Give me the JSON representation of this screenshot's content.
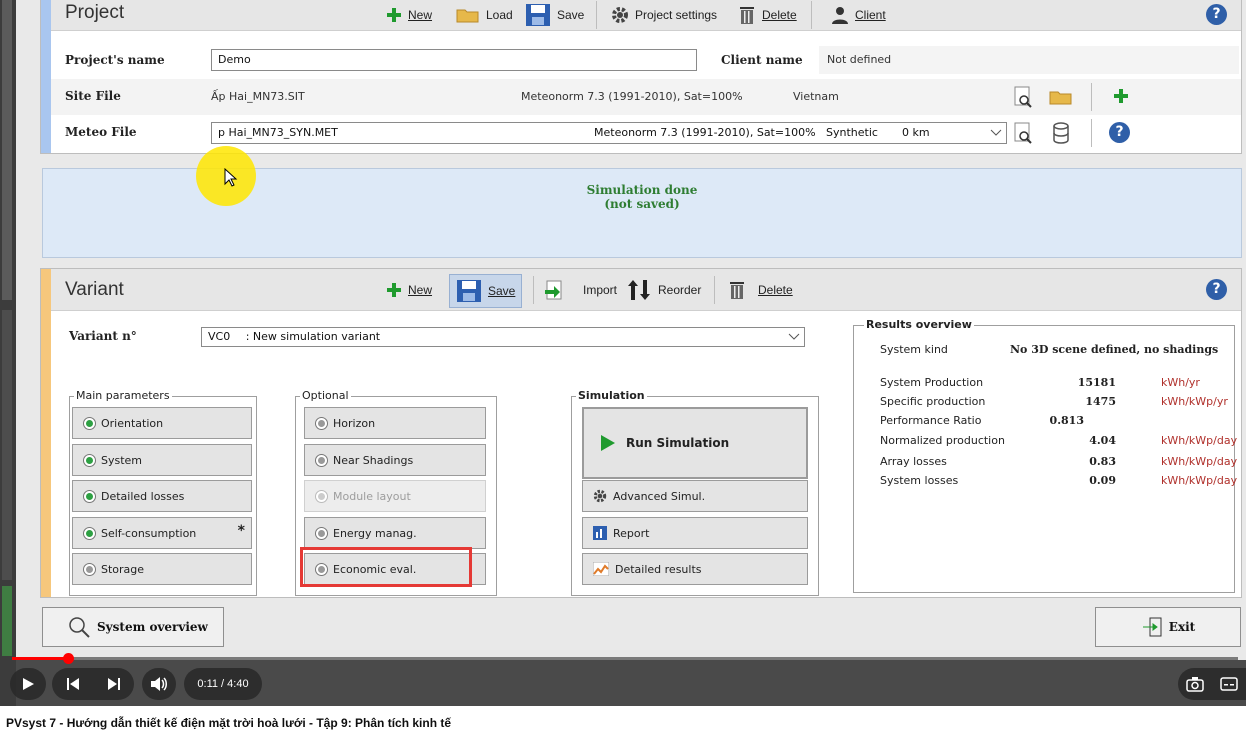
{
  "project": {
    "title": "Project",
    "toolbar": {
      "new": "New",
      "load": "Load",
      "save": "Save",
      "settings": "Project settings",
      "delete": "Delete",
      "client": "Client"
    },
    "name_label": "Project's name",
    "name_value": "Demo",
    "client_label": "Client name",
    "client_value": "Not defined",
    "site_label": "Site File",
    "site_file": "Ấp Hai_MN73.SIT",
    "site_meteo": "Meteonorm 7.3 (1991-2010), Sat=100%",
    "site_country": "Vietnam",
    "meteo_label": "Meteo File",
    "meteo_file": "p Hai_MN73_SYN.MET",
    "meteo_source": "Meteonorm 7.3 (1991-2010), Sat=100%",
    "meteo_type": "Synthetic",
    "meteo_dist": "0 km"
  },
  "status": {
    "line1": "Simulation done",
    "line2": "(not saved)"
  },
  "variant": {
    "title": "Variant",
    "toolbar": {
      "new": "New",
      "save": "Save",
      "import": "Import",
      "reorder": "Reorder",
      "delete": "Delete"
    },
    "number_label": "Variant n°",
    "number_code": "VC0",
    "number_name": ": New simulation variant"
  },
  "main_parameters": {
    "legend": "Main parameters",
    "items": [
      "Orientation",
      "System",
      "Detailed losses",
      "Self-consumption",
      "Storage"
    ],
    "self_consumption_mark": "*"
  },
  "optional": {
    "legend": "Optional",
    "items": [
      "Horizon",
      "Near Shadings",
      "Module layout",
      "Energy manag.",
      "Economic eval."
    ]
  },
  "simulation": {
    "legend": "Simulation",
    "run": "Run Simulation",
    "advanced": "Advanced Simul.",
    "report": "Report",
    "detailed": "Detailed results"
  },
  "results": {
    "legend": "Results overview",
    "system_kind_label": "System kind",
    "system_kind_value": "No 3D scene defined, no shadings",
    "rows": [
      {
        "label": "System Production",
        "value": "15181",
        "unit": "kWh/yr"
      },
      {
        "label": "Specific production",
        "value": "1475",
        "unit": "kWh/kWp/yr"
      },
      {
        "label": "Performance Ratio",
        "value": "0.813",
        "unit": ""
      },
      {
        "label": "Normalized production",
        "value": "4.04",
        "unit": "kWh/kWp/day"
      },
      {
        "label": "Array losses",
        "value": "0.83",
        "unit": "kWh/kWp/day"
      },
      {
        "label": "System losses",
        "value": "0.09",
        "unit": "kWh/kWp/day"
      }
    ]
  },
  "bottom": {
    "system_overview": "System overview",
    "exit": "Exit"
  },
  "player": {
    "time": "0:11 / 4:40",
    "progress_fraction": 0.04
  },
  "caption": "PVsyst 7 - Hướng dẫn thiết kế điện mặt trời hoà lưới - Tập 9: Phân tích kinh tế",
  "colors": {
    "project_accent": "#a9c6ef",
    "variant_accent": "#f6c77c",
    "status_bg": "#dde9f7",
    "status_text": "#2e7d32",
    "highlight": "#e53935",
    "unit_red": "#b0302b"
  }
}
